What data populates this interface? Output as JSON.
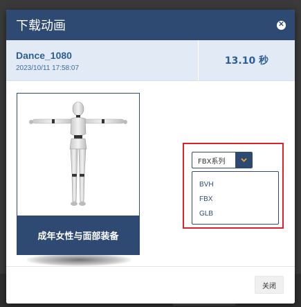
{
  "modal": {
    "title": "下载动画",
    "close_icon": "close-icon"
  },
  "animation": {
    "name": "Dance_1080",
    "datetime": "2023/10/11 17:58:07",
    "duration": "13.10 秒"
  },
  "model": {
    "label": "成年女性与面部装备",
    "figure_icon": "humanoid-robot-figure"
  },
  "format_select": {
    "selected": "FBX系列",
    "caret_icon": "chevron-down-icon",
    "options": [
      "BVH",
      "FBX",
      "GLB"
    ]
  },
  "footer": {
    "close_label": "关闭"
  },
  "colors": {
    "header": "#2e4a72",
    "info_bar": "#e2ebf5",
    "highlight": "#e0202a",
    "caret_arrow": "#f5a623"
  }
}
